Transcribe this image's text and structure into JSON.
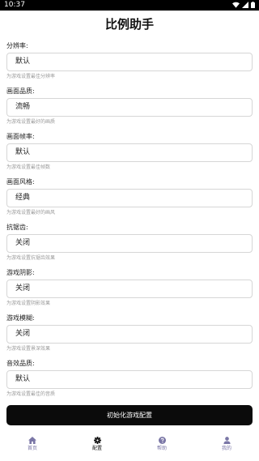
{
  "status": {
    "time": "10:37"
  },
  "page": {
    "title": "比例助手"
  },
  "fields": [
    {
      "label": "分辨率:",
      "value": "默认",
      "hint": "为游戏设置最佳分辨率"
    },
    {
      "label": "画面品质:",
      "value": "流畅",
      "hint": "为游戏设置最好的画质"
    },
    {
      "label": "画面帧率:",
      "value": "默认",
      "hint": "为游戏设置最佳帧数"
    },
    {
      "label": "画面风格:",
      "value": "经典",
      "hint": "为游戏设置最好的画风"
    },
    {
      "label": "抗锯齿:",
      "value": "关闭",
      "hint": "为游戏设置抗锯齿效果"
    },
    {
      "label": "游戏阴影:",
      "value": "关闭",
      "hint": "为游戏设置阴影效果"
    },
    {
      "label": "游戏模糊:",
      "value": "关闭",
      "hint": "为游戏设置景深效果"
    },
    {
      "label": "音效品质:",
      "value": "默认",
      "hint": "为游戏设置最佳的音质"
    }
  ],
  "actions": {
    "init_label": "初始化游戏配置"
  },
  "tabs": [
    {
      "label": "首页",
      "icon": "home-icon",
      "active": false
    },
    {
      "label": "配置",
      "icon": "gear-icon",
      "active": true
    },
    {
      "label": "帮助",
      "icon": "help-icon",
      "active": false
    },
    {
      "label": "我的",
      "icon": "user-icon",
      "active": false
    }
  ],
  "colors": {
    "accent": "#0b0b0b",
    "inactive_tab": "#7a76a6",
    "active_tab": "#111111"
  }
}
